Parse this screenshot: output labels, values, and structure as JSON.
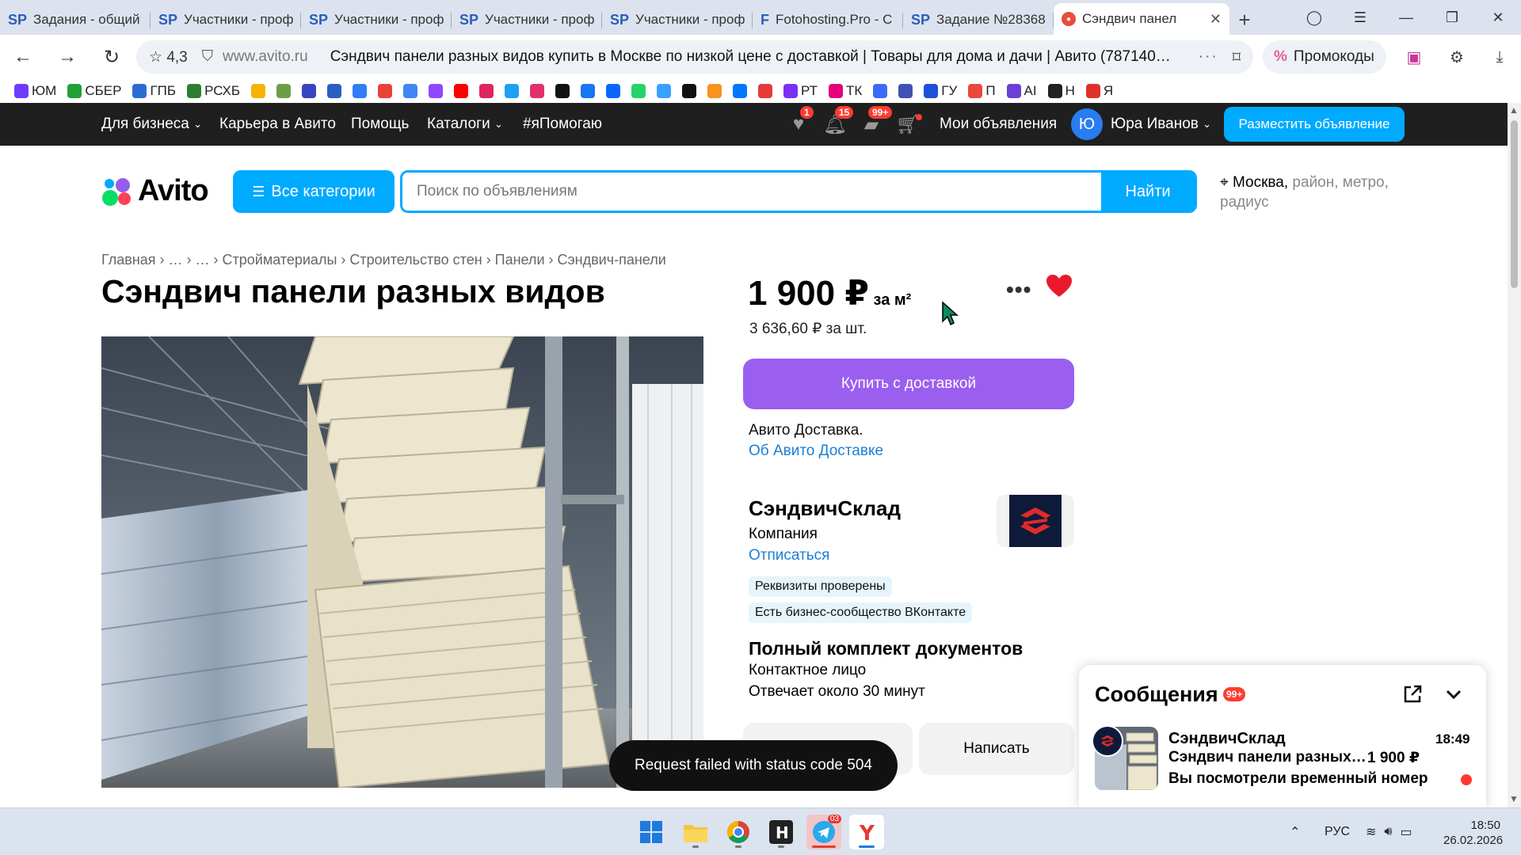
{
  "browser": {
    "tabs": [
      {
        "icon": "SP",
        "title": "Задания - общий с"
      },
      {
        "icon": "SP",
        "title": "Участники - проф"
      },
      {
        "icon": "SP",
        "title": "Участники - проф"
      },
      {
        "icon": "SP",
        "title": "Участники - проф"
      },
      {
        "icon": "SP",
        "title": "Участники - проф"
      },
      {
        "icon": "F",
        "title": "Fotohosting.Pro - С"
      },
      {
        "icon": "SP",
        "title": "Задание №28368"
      },
      {
        "icon": "●",
        "title": "Сэндвич панел",
        "active": true
      }
    ],
    "rating": "4,3",
    "domain": "www.avito.ru",
    "page_title": "Сэндвич панели разных видов купить в Москве по низкой цене с доставкой | Товары для дома и дачи | Авито (787140…",
    "promo_label": "Промокоды",
    "bookmarks": [
      {
        "label": "ЮМ",
        "color": "#6f3bff"
      },
      {
        "label": "СБЕР",
        "color": "#21a038"
      },
      {
        "label": "ГПБ",
        "color": "#2b6cd3"
      },
      {
        "label": "РСХБ",
        "color": "#2f7d32"
      },
      {
        "label": "",
        "color": "#f5b400"
      },
      {
        "label": "",
        "color": "#6b9d46"
      },
      {
        "label": "",
        "color": "#3a43c0"
      },
      {
        "label": "",
        "color": "#2a5ebf"
      },
      {
        "label": "",
        "color": "#2f7ef5"
      },
      {
        "label": "",
        "color": "#ea4335"
      },
      {
        "label": "",
        "color": "#4285f4"
      },
      {
        "label": "",
        "color": "#9146ff"
      },
      {
        "label": "",
        "color": "#ff0000"
      },
      {
        "label": "",
        "color": "#e0245e"
      },
      {
        "label": "",
        "color": "#1da1f2"
      },
      {
        "label": "",
        "color": "#e1306c"
      },
      {
        "label": "",
        "color": "#111111"
      },
      {
        "label": "",
        "color": "#1877f2"
      },
      {
        "label": "",
        "color": "#0a66ff"
      },
      {
        "label": "",
        "color": "#25d366"
      },
      {
        "label": "",
        "color": "#3aa0ff"
      },
      {
        "label": "",
        "color": "#111111"
      },
      {
        "label": "",
        "color": "#f7931e"
      },
      {
        "label": "",
        "color": "#0077ff"
      },
      {
        "label": "",
        "color": "#e63939"
      },
      {
        "label": "РТ",
        "color": "#7b2ff7"
      },
      {
        "label": "ТК",
        "color": "#e6007e"
      },
      {
        "label": "",
        "color": "#3b6cf6"
      },
      {
        "label": "",
        "color": "#3f51b5"
      },
      {
        "label": "ГУ",
        "color": "#1e4fd8"
      },
      {
        "label": "П",
        "color": "#e8493a"
      },
      {
        "label": "AI",
        "color": "#6b3fd8"
      },
      {
        "label": "Н",
        "color": "#222222"
      },
      {
        "label": "Я",
        "color": "#e0302c"
      }
    ]
  },
  "topbar": {
    "for_business": "Для бизнеса",
    "career": "Карьера в Авито",
    "help": "Помощь",
    "catalogs": "Каталоги",
    "ya_pomogayu": "#яПомогаю",
    "fav_badge": "1",
    "notif_badge": "15",
    "msg_badge": "99+",
    "my_ads": "Мои объявления",
    "avatar_letter": "Ю",
    "user_name": "Юра Иванов",
    "post_ad": "Разместить объявление"
  },
  "header": {
    "logo": "Avito",
    "all_categories": "Все категории",
    "search_placeholder": "Поиск по объявлениям",
    "find": "Найти",
    "location_city": "Москва,",
    "location_rest": " район, метро, радиус"
  },
  "breadcrumbs": "Главная › … › … › Стройматериалы › Строительство стен › Панели › Сэндвич-панели",
  "listing": {
    "title": "Сэндвич панели разных видов",
    "price": "1 900 ₽",
    "price_unit": " за м²",
    "price_per_piece": "3 636,60 ₽ за шт.",
    "buy_button": "Купить с доставкой",
    "delivery_text": "Авито Доставка.",
    "delivery_link": "Об Авито Доставке"
  },
  "seller": {
    "name": "СэндвичСклад",
    "type": "Компания",
    "unsubscribe": "Отписаться",
    "tags": [
      "Реквизиты проверены",
      "Есть бизнес-сообщество ВКонтакте"
    ],
    "docs": "Полный комплект документов",
    "contact": "Контактное лицо",
    "response": "Отвечает около 30 минут",
    "write_button": "Написать"
  },
  "toast": "Request failed with status code 504",
  "messages": {
    "title": "Сообщения",
    "badge": "99+",
    "item": {
      "sender": "СэндвичСклад",
      "time": "18:49",
      "listing": "Сэндвич панели разных видов",
      "price": "1 900 ₽",
      "preview": "Вы посмотрели временный номер"
    }
  },
  "taskbar": {
    "telegram_badge": "03",
    "lang": "РУС",
    "time": "18:50",
    "date": "26.02.2026"
  },
  "colors": {
    "avito_blue": "#00aaff",
    "buy_purple": "#9b5ff0",
    "link_blue": "#1a7fd6",
    "badge_red": "#ff3b30",
    "favorite_red": "#e8192c",
    "topbar_bg": "#1f1f1f"
  }
}
